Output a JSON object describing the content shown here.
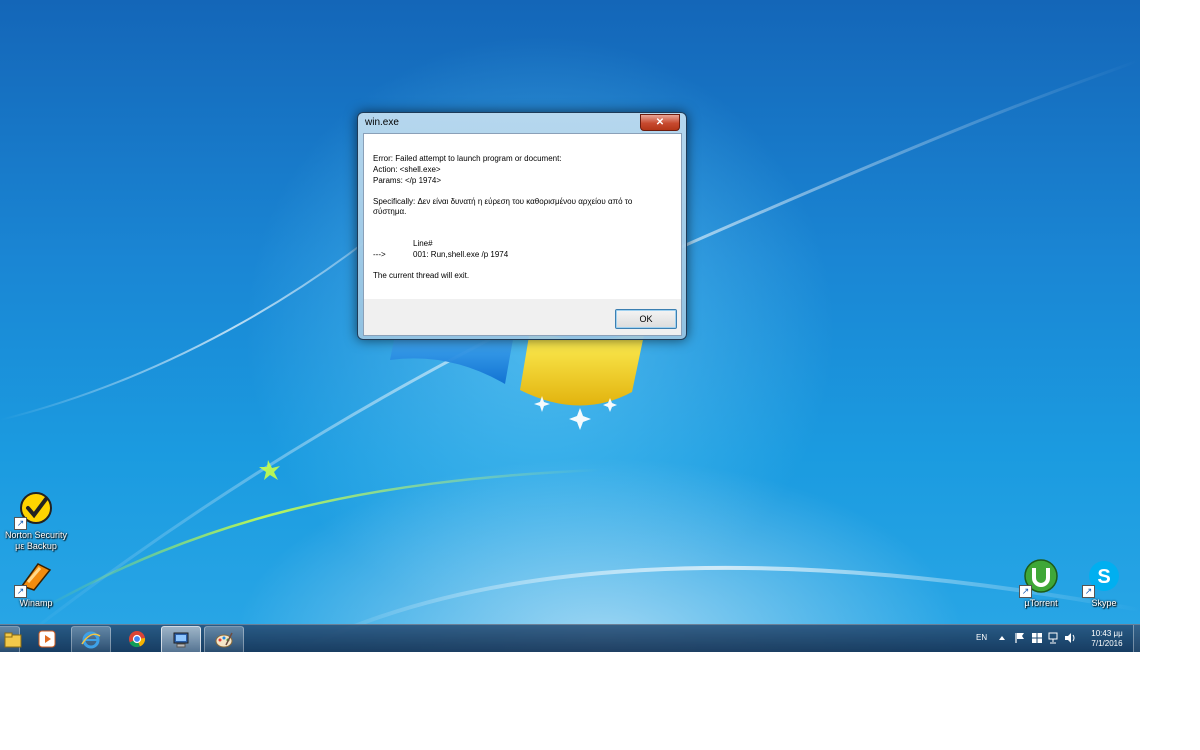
{
  "dialog": {
    "title": "win.exe",
    "close_label": "✕",
    "lines": [
      "Error:  Failed attempt to launch program or document:",
      "Action: <shell.exe>",
      "Params: </p 1974>",
      "Specifically: Δεν είναι δυνατή η εύρεση του καθορισμένου αρχείου από το",
      "σύστημα.",
      "Line#",
      "--->",
      "001: Run,shell.exe /p 1974",
      "The current thread will exit."
    ],
    "ok_label": "OK"
  },
  "desktop_icons": [
    {
      "name": "Norton Security",
      "label_line1": "Norton Security",
      "label_line2": "με Backup",
      "icon": "norton-icon"
    },
    {
      "name": "Winamp",
      "label_line1": "Winamp",
      "icon": "winamp-icon"
    },
    {
      "name": "µTorrent",
      "label_line1": "µTorrent",
      "icon": "utorrent-icon"
    },
    {
      "name": "Skype",
      "label_line1": "Skype",
      "icon": "skype-icon"
    }
  ],
  "taskbar": {
    "pinned": [
      "explorer-icon",
      "media-player-icon",
      "internet-explorer-icon",
      "chrome-icon",
      "win-exe-icon",
      "paint-icon"
    ],
    "language": "EN",
    "clock_time": "10:43 μμ",
    "clock_date": "7/1/2016"
  },
  "colors": {
    "desktop": "#1a86d4",
    "taskbar": "#1e3f63",
    "close_button": "#c7492f"
  }
}
